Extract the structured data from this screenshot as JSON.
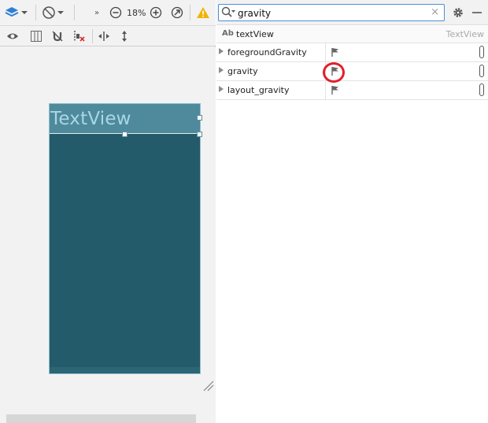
{
  "toolbar": {
    "layers_icon": "layers-icon",
    "orientation_icon": "rotate-icon",
    "overflow_icon": "double-chevron-icon",
    "zoom_out_icon": "minus-circle-icon",
    "zoom_level": "18%",
    "zoom_in_icon": "plus-circle-icon",
    "zoom_fit_icon": "fit-icon",
    "warning_icon": "warning-icon",
    "warning_color": "#f0b400"
  },
  "design_tools": [
    "eye-icon",
    "blueprint-icon",
    "magnet-off-icon",
    "clear-constraints-icon",
    "pack-horizontal-icon",
    "pack-vertical-icon"
  ],
  "preview": {
    "widget_text": "TextView",
    "device_color": "#235b6b",
    "widget_bg": "#4f8a9c"
  },
  "attributes": {
    "search": {
      "value": "gravity",
      "clear_label": "×"
    },
    "settings_icon": "gear-icon",
    "minimize_icon": "minus-icon",
    "component": {
      "badge": "Ab",
      "id": "textView",
      "type": "TextView"
    },
    "properties": [
      {
        "name": "foregroundGravity",
        "highlighted": false
      },
      {
        "name": "gravity",
        "highlighted": true
      },
      {
        "name": "layout_gravity",
        "highlighted": false
      }
    ],
    "highlight_color": "#e0202a"
  }
}
